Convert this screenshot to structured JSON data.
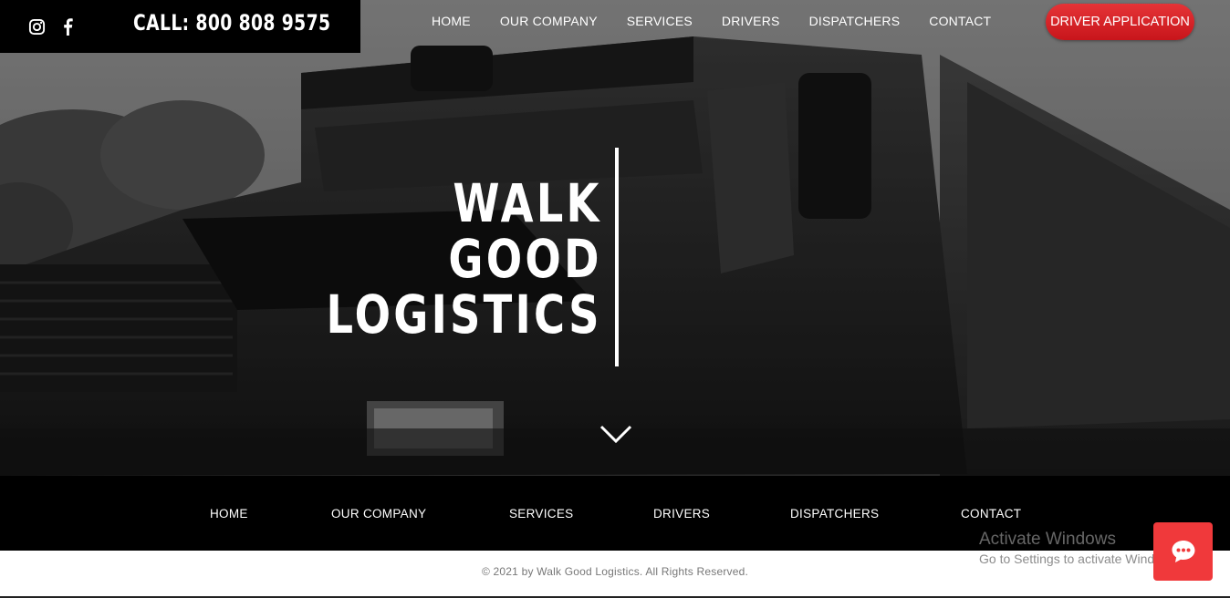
{
  "header": {
    "call_text": "CALL: 800 808 9575",
    "social": [
      {
        "icon": "instagram-icon"
      },
      {
        "icon": "facebook-icon"
      }
    ],
    "nav": [
      "HOME",
      "OUR COMPANY",
      "SERVICES",
      "DRIVERS",
      "DISPATCHERS",
      "CONTACT"
    ],
    "apply_label": "DRIVER APPLICATION"
  },
  "hero": {
    "title_lines": [
      "WALK",
      "GOOD",
      "LOGISTICS"
    ],
    "scroll_icon": "chevron-down-icon"
  },
  "footer": {
    "nav": [
      "HOME",
      "OUR COMPANY",
      "SERVICES",
      "DRIVERS",
      "DISPATCHERS",
      "CONTACT"
    ],
    "copyright": "© 2021 by Walk Good Logistics. All Rights Reserved."
  },
  "overlay": {
    "activate_title": "Activate Windows",
    "activate_sub": "Go to Settings to activate Windows."
  },
  "chat": {
    "icon": "chat-bubble-icon"
  },
  "colors": {
    "accent": "#e53437",
    "chat": "#f0393b",
    "black": "#000000"
  }
}
